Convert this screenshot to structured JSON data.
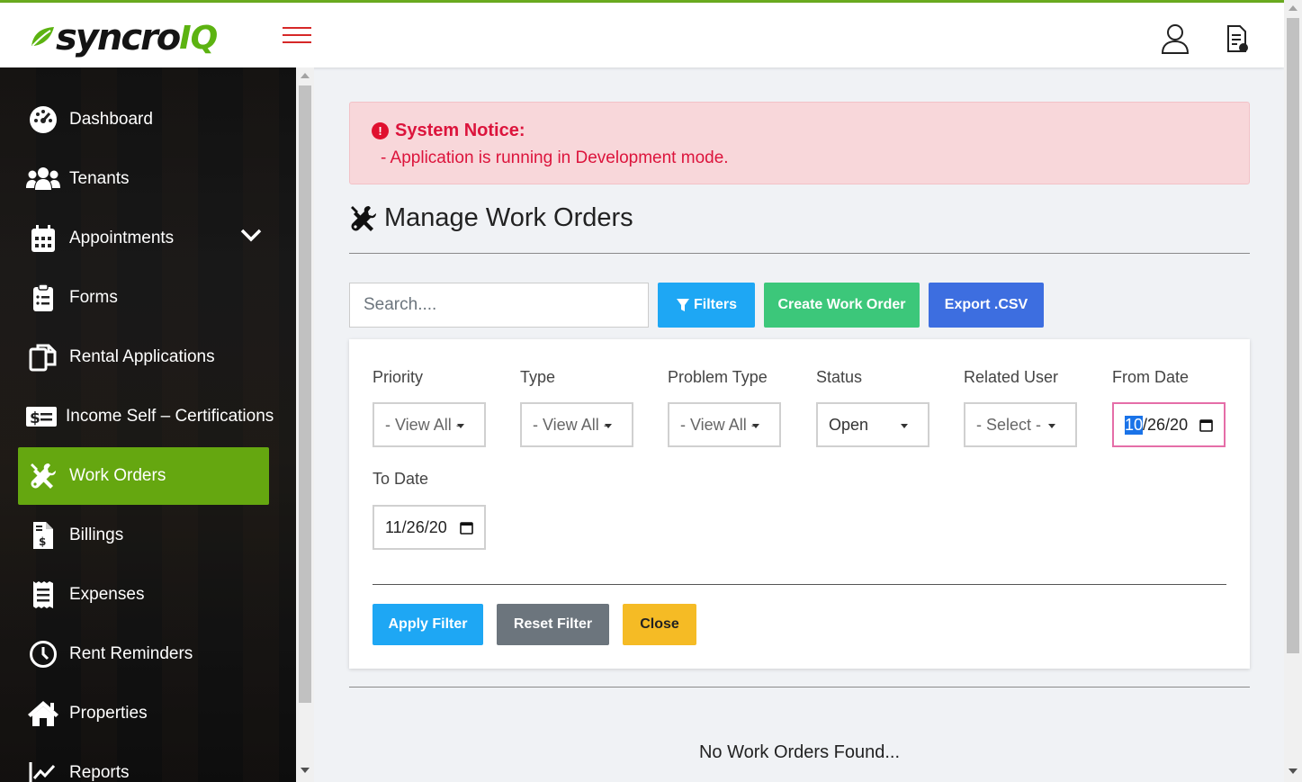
{
  "header": {
    "logo_text": "syncro",
    "logo_suffix": "IQ",
    "menu_icon": "hamburger-icon",
    "user_icon": "user-icon",
    "doc_icon": "document-icon"
  },
  "sidebar": {
    "items": [
      {
        "label": "Dashboard",
        "icon": "dashboard-icon"
      },
      {
        "label": "Tenants",
        "icon": "users-icon"
      },
      {
        "label": "Appointments",
        "icon": "calendar-icon"
      },
      {
        "label": "Forms",
        "icon": "clipboard-icon"
      },
      {
        "label": "Rental Applications",
        "icon": "copy-icon"
      },
      {
        "label": "Income Self – Certifications",
        "icon": "money-icon"
      },
      {
        "label": "Work Orders",
        "icon": "tools-icon",
        "active": true
      },
      {
        "label": "Billings",
        "icon": "invoice-icon"
      },
      {
        "label": "Expenses",
        "icon": "receipt-icon"
      },
      {
        "label": "Rent Reminders",
        "icon": "clock-icon"
      },
      {
        "label": "Properties",
        "icon": "home-icon"
      },
      {
        "label": "Reports",
        "icon": "chart-line-icon"
      }
    ]
  },
  "notice": {
    "title": "System Notice:",
    "message": "- Application is running in Development mode."
  },
  "page": {
    "title": "Manage Work Orders"
  },
  "toolbar": {
    "search_placeholder": "Search....",
    "filters_label": "Filters",
    "create_label": "Create Work Order",
    "export_label": "Export .CSV"
  },
  "filters": {
    "priority": {
      "label": "Priority",
      "value": "- View All -"
    },
    "type": {
      "label": "Type",
      "value": "- View All -"
    },
    "problem_type": {
      "label": "Problem Type",
      "value": "- View All -"
    },
    "status": {
      "label": "Status",
      "value": "Open"
    },
    "related_user": {
      "label": "Related User",
      "value": "- Select -"
    },
    "from_date": {
      "label": "From Date",
      "month": "10",
      "rest": "/26/20"
    },
    "to_date": {
      "label": "To Date",
      "value": "11/26/20"
    },
    "apply_label": "Apply Filter",
    "reset_label": "Reset Filter",
    "close_label": "Close"
  },
  "results": {
    "empty_message": "No Work Orders Found..."
  },
  "colors": {
    "brand_green": "#65a710",
    "notice_bg": "#f8d7da",
    "notice_text": "#dc143c",
    "info": "#1ea7f4",
    "success": "#3cc77a",
    "primary": "#3d6ee0",
    "secondary": "#6c757d",
    "warning": "#f5bb25"
  }
}
